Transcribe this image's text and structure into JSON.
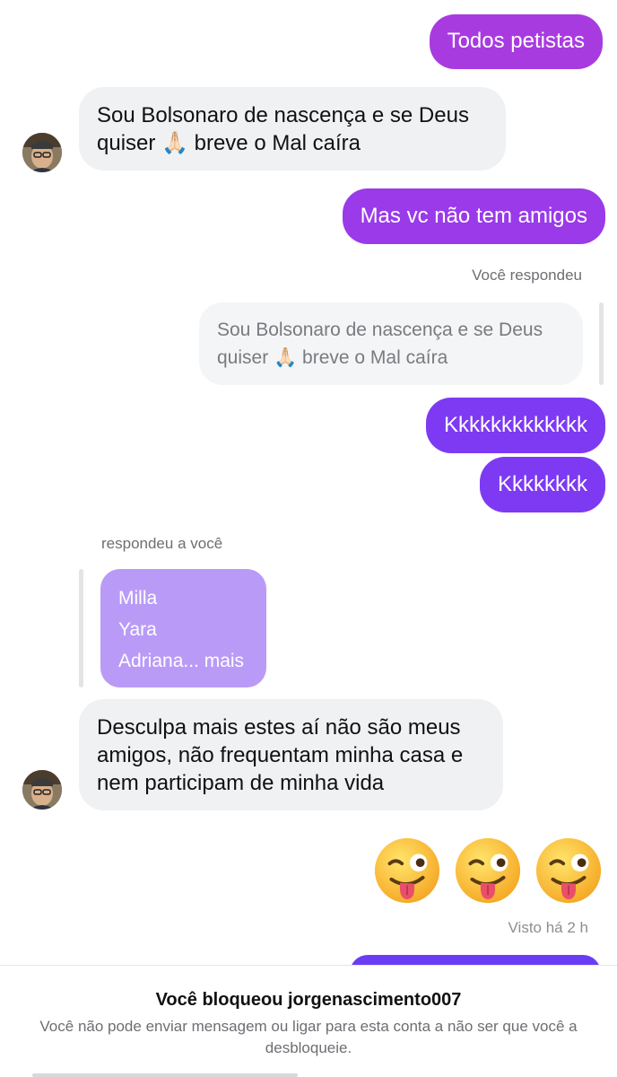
{
  "messages": {
    "m1": "Todos petistas",
    "m2_line1": "Sou Bolsonaro de nascença e se Deus",
    "m2_line2_a": "quiser",
    "m2_line2_b": "breve o Mal caíra",
    "m3": "Mas vc não tem amigos",
    "m4": "Kkkkkkkkkkkkk",
    "m5": "Kkkkkkkk",
    "m6_line1": "Desculpa mais estes aí não são meus",
    "m6_line2": "amigos, não frequentam minha casa e",
    "m6_line3": "nem participam de minha vida"
  },
  "labels": {
    "you_replied": "Você respondeu",
    "replied_to_you": "respondeu a você",
    "seen": "Visto há 2 h"
  },
  "quoted": {
    "line1": "Sou Bolsonaro de nascença e se Deus",
    "line2_a": "quiser",
    "line2_b": "breve o Mal caíra"
  },
  "reply_card": {
    "line1": "Milla",
    "line2": "Yara",
    "line3": "Adriana... mais"
  },
  "emojis": [
    "winking-face-with-tongue",
    "winking-face-with-tongue",
    "winking-face-with-tongue"
  ],
  "blocked": {
    "title": "Você bloqueou jorgenascimento007",
    "description": "Você não pode enviar mensagem ou ligar para esta conta a não ser que você a desbloqueie."
  },
  "colors": {
    "outgoing_1": "#a83be0",
    "outgoing_2": "#9a3ae8",
    "outgoing_3": "#7d3af2",
    "incoming_bg": "#eff1f3",
    "reply_card_bg": "#b99bf7"
  }
}
